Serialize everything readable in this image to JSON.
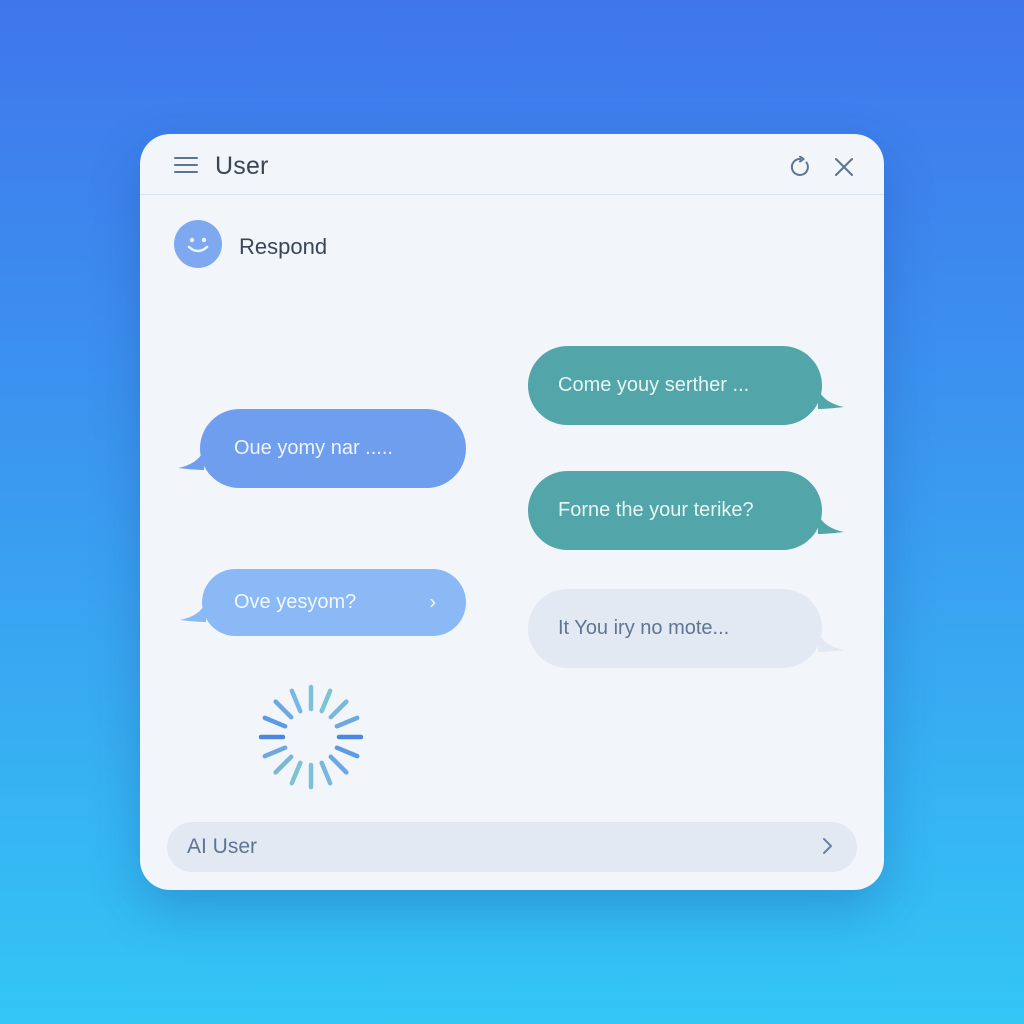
{
  "window": {
    "title": "User",
    "icons": {
      "menu": "hamburger-menu-icon",
      "refresh": "refresh-icon",
      "close": "close-icon"
    }
  },
  "responder": {
    "name": "Respond",
    "avatar_icon": "smiley-avatar-icon"
  },
  "messages": [
    {
      "side": "right",
      "text": "Come youy serther  ...",
      "color": "#52a5a8"
    },
    {
      "side": "left",
      "text": "Oue yomy nar  .....",
      "color": "#6f9eef"
    },
    {
      "side": "right",
      "text": "Forne the your terike?",
      "color": "#52a5a8"
    },
    {
      "side": "left",
      "text": "Ove yesyom?",
      "color": "#8ab9f6",
      "chevron": "›"
    },
    {
      "side": "right",
      "text": "It You iry no mote...",
      "color": "#e3e9f2"
    }
  ],
  "loading_indicator": "spinner-icon",
  "input": {
    "label": "AI User",
    "send_icon": "chevron-right-icon"
  },
  "colors": {
    "background_top": "#3f76ec",
    "background_bottom": "#33c6f5",
    "window": "#f2f5fa",
    "teal_bubble": "#52a5a8",
    "blue_bubble": "#6f9eef",
    "light_blue_bubble": "#8ab9f6",
    "grey_bubble": "#e3e9f2"
  }
}
